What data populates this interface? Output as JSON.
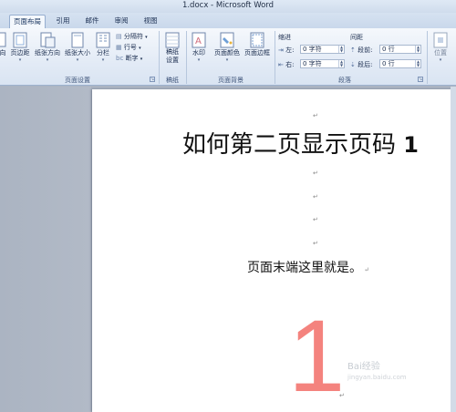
{
  "window": {
    "title": "1.docx - Microsoft Word"
  },
  "tabs": [
    {
      "label": "页面布局",
      "active": true
    },
    {
      "label": "引用",
      "active": false
    },
    {
      "label": "邮件",
      "active": false
    },
    {
      "label": "审阅",
      "active": false
    },
    {
      "label": "视图",
      "active": false
    }
  ],
  "ribbon": {
    "page_setup": {
      "label": "页面设置",
      "orientation_partial": "向",
      "margins": "页边距",
      "paper_direction": "纸张方向",
      "paper_size": "纸张大小",
      "columns": "分栏",
      "breaks": "分隔符",
      "line_numbers": "行号",
      "hyphenation": "断字"
    },
    "manuscript": {
      "label": "稿纸",
      "button": "稿纸\n设置"
    },
    "page_background": {
      "label": "页面背景",
      "watermark": "水印",
      "page_color": "页面颜色",
      "page_border": "页面边框"
    },
    "paragraph": {
      "label": "段落",
      "indent_header": "缩进",
      "spacing_header": "间距",
      "indent_left_label": "左:",
      "indent_left_value": "0 字符",
      "indent_right_label": "右:",
      "indent_right_value": "0 字符",
      "spacing_before_label": "段前:",
      "spacing_before_value": "0 行",
      "spacing_after_label": "段后:",
      "spacing_after_value": "0 行"
    },
    "arrange": {
      "position": "位置"
    }
  },
  "document": {
    "heading_text": "如何第二页显示页码 ",
    "heading_num": "1",
    "body_text": "页面末端这里就是。",
    "page_number": "1",
    "watermark_main": "Bai经验",
    "watermark_sub": "jingyan.baidu.com"
  },
  "colors": {
    "page_number": "#f4837e",
    "ribbon_bg": "#e3ebf6",
    "workspace_bg": "#abb4c2"
  }
}
